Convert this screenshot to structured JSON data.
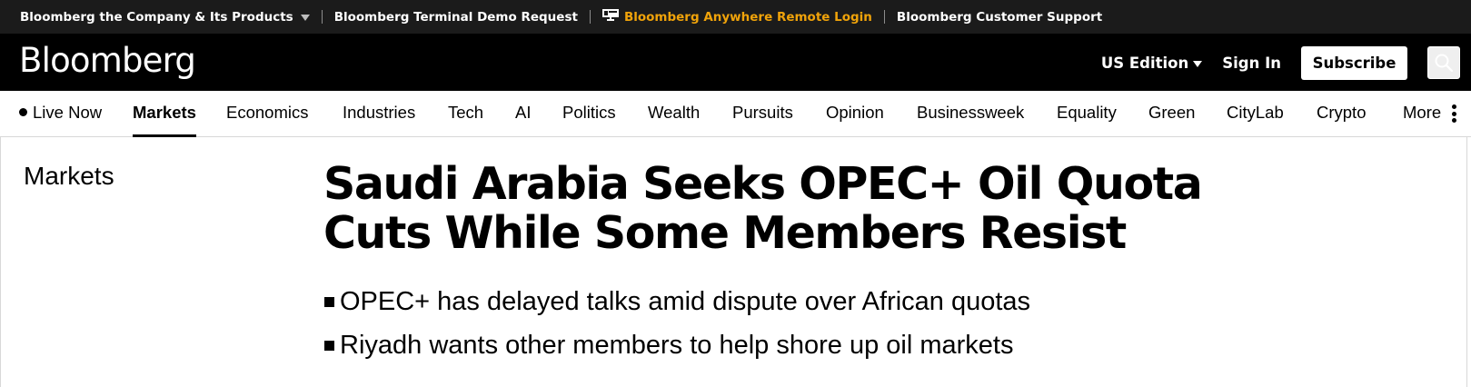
{
  "utility_bar": {
    "company_products": "Bloomberg the Company & Its Products",
    "terminal_demo": "Bloomberg Terminal Demo Request",
    "anywhere_login": "Bloomberg Anywhere Remote Login",
    "customer_support": "Bloomberg Customer Support",
    "accent_color": "#f0a30a"
  },
  "masthead": {
    "logo": "Bloomberg",
    "edition": "US Edition",
    "sign_in": "Sign In",
    "subscribe": "Subscribe",
    "search_icon": "search-icon"
  },
  "nav": {
    "items": [
      {
        "label": "Live Now"
      },
      {
        "label": "Markets"
      },
      {
        "label": "Economics"
      },
      {
        "label": "Industries"
      },
      {
        "label": "Tech"
      },
      {
        "label": "AI"
      },
      {
        "label": "Politics"
      },
      {
        "label": "Wealth"
      },
      {
        "label": "Pursuits"
      },
      {
        "label": "Opinion"
      },
      {
        "label": "Businessweek"
      },
      {
        "label": "Equality"
      },
      {
        "label": "Green"
      },
      {
        "label": "CityLab"
      },
      {
        "label": "Crypto"
      },
      {
        "label": "More"
      }
    ],
    "active": "Markets"
  },
  "article": {
    "section": "Markets",
    "headline": "Saudi Arabia Seeks OPEC+ Oil Quota Cuts While Some Members Resist",
    "bullets": [
      "OPEC+ has delayed talks amid dispute over African quotas",
      "Riyadh wants other members to help shore up oil markets"
    ]
  }
}
